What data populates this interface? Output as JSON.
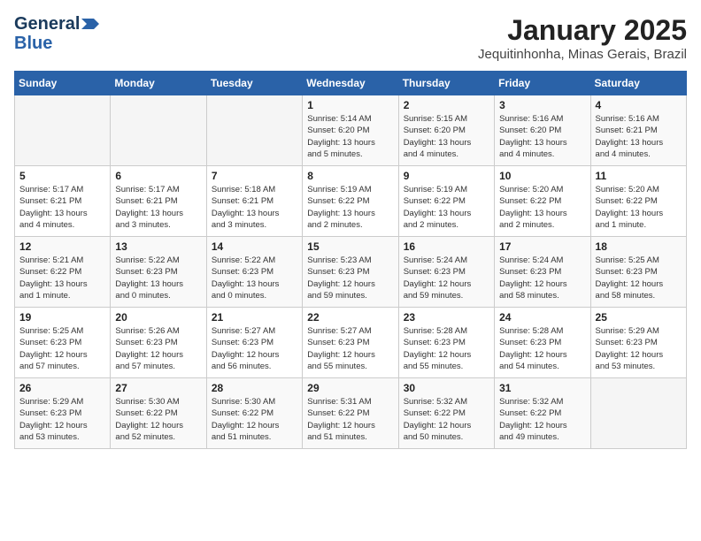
{
  "header": {
    "logo_line1": "General",
    "logo_line2": "Blue",
    "month_title": "January 2025",
    "location": "Jequitinhonha, Minas Gerais, Brazil"
  },
  "weekdays": [
    "Sunday",
    "Monday",
    "Tuesday",
    "Wednesday",
    "Thursday",
    "Friday",
    "Saturday"
  ],
  "weeks": [
    [
      {
        "day": "",
        "info": ""
      },
      {
        "day": "",
        "info": ""
      },
      {
        "day": "",
        "info": ""
      },
      {
        "day": "1",
        "info": "Sunrise: 5:14 AM\nSunset: 6:20 PM\nDaylight: 13 hours\nand 5 minutes."
      },
      {
        "day": "2",
        "info": "Sunrise: 5:15 AM\nSunset: 6:20 PM\nDaylight: 13 hours\nand 4 minutes."
      },
      {
        "day": "3",
        "info": "Sunrise: 5:16 AM\nSunset: 6:20 PM\nDaylight: 13 hours\nand 4 minutes."
      },
      {
        "day": "4",
        "info": "Sunrise: 5:16 AM\nSunset: 6:21 PM\nDaylight: 13 hours\nand 4 minutes."
      }
    ],
    [
      {
        "day": "5",
        "info": "Sunrise: 5:17 AM\nSunset: 6:21 PM\nDaylight: 13 hours\nand 4 minutes."
      },
      {
        "day": "6",
        "info": "Sunrise: 5:17 AM\nSunset: 6:21 PM\nDaylight: 13 hours\nand 3 minutes."
      },
      {
        "day": "7",
        "info": "Sunrise: 5:18 AM\nSunset: 6:21 PM\nDaylight: 13 hours\nand 3 minutes."
      },
      {
        "day": "8",
        "info": "Sunrise: 5:19 AM\nSunset: 6:22 PM\nDaylight: 13 hours\nand 2 minutes."
      },
      {
        "day": "9",
        "info": "Sunrise: 5:19 AM\nSunset: 6:22 PM\nDaylight: 13 hours\nand 2 minutes."
      },
      {
        "day": "10",
        "info": "Sunrise: 5:20 AM\nSunset: 6:22 PM\nDaylight: 13 hours\nand 2 minutes."
      },
      {
        "day": "11",
        "info": "Sunrise: 5:20 AM\nSunset: 6:22 PM\nDaylight: 13 hours\nand 1 minute."
      }
    ],
    [
      {
        "day": "12",
        "info": "Sunrise: 5:21 AM\nSunset: 6:22 PM\nDaylight: 13 hours\nand 1 minute."
      },
      {
        "day": "13",
        "info": "Sunrise: 5:22 AM\nSunset: 6:23 PM\nDaylight: 13 hours\nand 0 minutes."
      },
      {
        "day": "14",
        "info": "Sunrise: 5:22 AM\nSunset: 6:23 PM\nDaylight: 13 hours\nand 0 minutes."
      },
      {
        "day": "15",
        "info": "Sunrise: 5:23 AM\nSunset: 6:23 PM\nDaylight: 12 hours\nand 59 minutes."
      },
      {
        "day": "16",
        "info": "Sunrise: 5:24 AM\nSunset: 6:23 PM\nDaylight: 12 hours\nand 59 minutes."
      },
      {
        "day": "17",
        "info": "Sunrise: 5:24 AM\nSunset: 6:23 PM\nDaylight: 12 hours\nand 58 minutes."
      },
      {
        "day": "18",
        "info": "Sunrise: 5:25 AM\nSunset: 6:23 PM\nDaylight: 12 hours\nand 58 minutes."
      }
    ],
    [
      {
        "day": "19",
        "info": "Sunrise: 5:25 AM\nSunset: 6:23 PM\nDaylight: 12 hours\nand 57 minutes."
      },
      {
        "day": "20",
        "info": "Sunrise: 5:26 AM\nSunset: 6:23 PM\nDaylight: 12 hours\nand 57 minutes."
      },
      {
        "day": "21",
        "info": "Sunrise: 5:27 AM\nSunset: 6:23 PM\nDaylight: 12 hours\nand 56 minutes."
      },
      {
        "day": "22",
        "info": "Sunrise: 5:27 AM\nSunset: 6:23 PM\nDaylight: 12 hours\nand 55 minutes."
      },
      {
        "day": "23",
        "info": "Sunrise: 5:28 AM\nSunset: 6:23 PM\nDaylight: 12 hours\nand 55 minutes."
      },
      {
        "day": "24",
        "info": "Sunrise: 5:28 AM\nSunset: 6:23 PM\nDaylight: 12 hours\nand 54 minutes."
      },
      {
        "day": "25",
        "info": "Sunrise: 5:29 AM\nSunset: 6:23 PM\nDaylight: 12 hours\nand 53 minutes."
      }
    ],
    [
      {
        "day": "26",
        "info": "Sunrise: 5:29 AM\nSunset: 6:23 PM\nDaylight: 12 hours\nand 53 minutes."
      },
      {
        "day": "27",
        "info": "Sunrise: 5:30 AM\nSunset: 6:22 PM\nDaylight: 12 hours\nand 52 minutes."
      },
      {
        "day": "28",
        "info": "Sunrise: 5:30 AM\nSunset: 6:22 PM\nDaylight: 12 hours\nand 51 minutes."
      },
      {
        "day": "29",
        "info": "Sunrise: 5:31 AM\nSunset: 6:22 PM\nDaylight: 12 hours\nand 51 minutes."
      },
      {
        "day": "30",
        "info": "Sunrise: 5:32 AM\nSunset: 6:22 PM\nDaylight: 12 hours\nand 50 minutes."
      },
      {
        "day": "31",
        "info": "Sunrise: 5:32 AM\nSunset: 6:22 PM\nDaylight: 12 hours\nand 49 minutes."
      },
      {
        "day": "",
        "info": ""
      }
    ]
  ]
}
